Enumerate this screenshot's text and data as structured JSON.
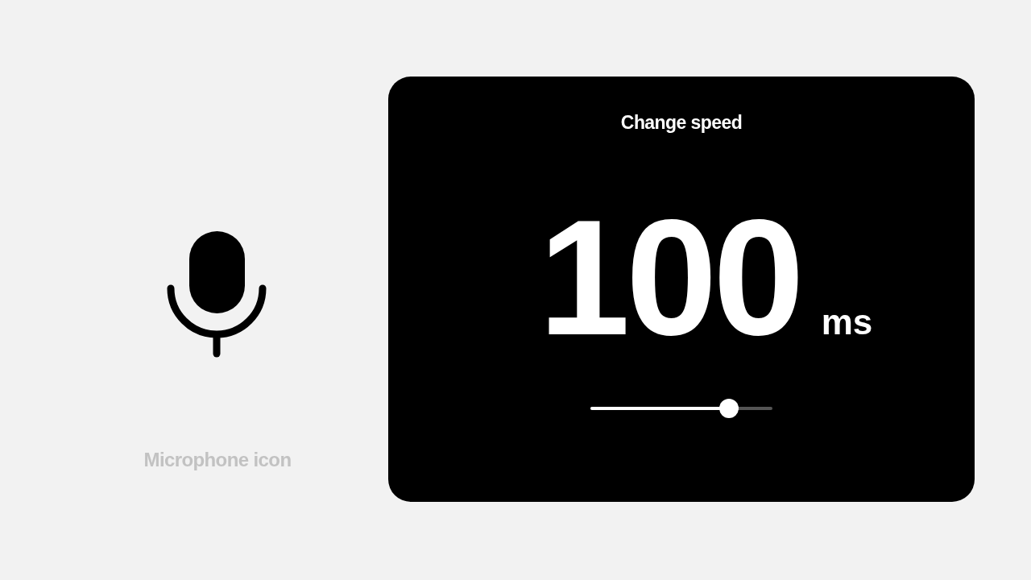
{
  "caption": "Microphone icon",
  "panel": {
    "title": "Change speed",
    "value": "100",
    "unit": "ms",
    "slider": {
      "level": 0.76
    }
  }
}
